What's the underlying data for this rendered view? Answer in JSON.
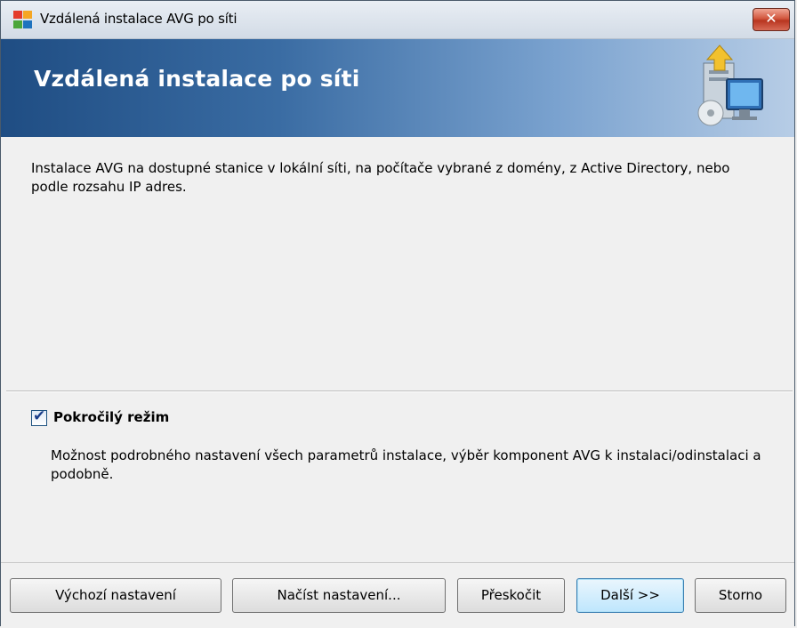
{
  "window": {
    "title": "Vzdálená instalace AVG po síti",
    "close_label": "✕"
  },
  "header": {
    "title": "Vzdálená instalace po síti"
  },
  "main": {
    "description": "Instalace AVG na dostupné stanice v lokální síti, na počítače vybrané z domény, z Active Directory, nebo podle rozsahu IP adres.",
    "advanced_mode": {
      "label": "Pokročilý režim",
      "checked": true,
      "check_glyph": "✔",
      "description": "Možnost podrobného nastavení všech parametrů instalace, výběr komponent AVG k instalaci/odinstalaci a podobně."
    }
  },
  "buttons": {
    "default_settings": "Výchozí nastavení",
    "load_settings": "Načíst nastavení...",
    "skip": "Přeskočit",
    "next": "Další >>",
    "cancel": "Storno"
  },
  "colors": {
    "header_dark": "#1f4d83",
    "header_light": "#b7cde6",
    "close_red": "#c0412a"
  },
  "icons": [
    "avg-logo-icon",
    "close-icon",
    "network-install-icon",
    "checkbox-checked-icon"
  ]
}
